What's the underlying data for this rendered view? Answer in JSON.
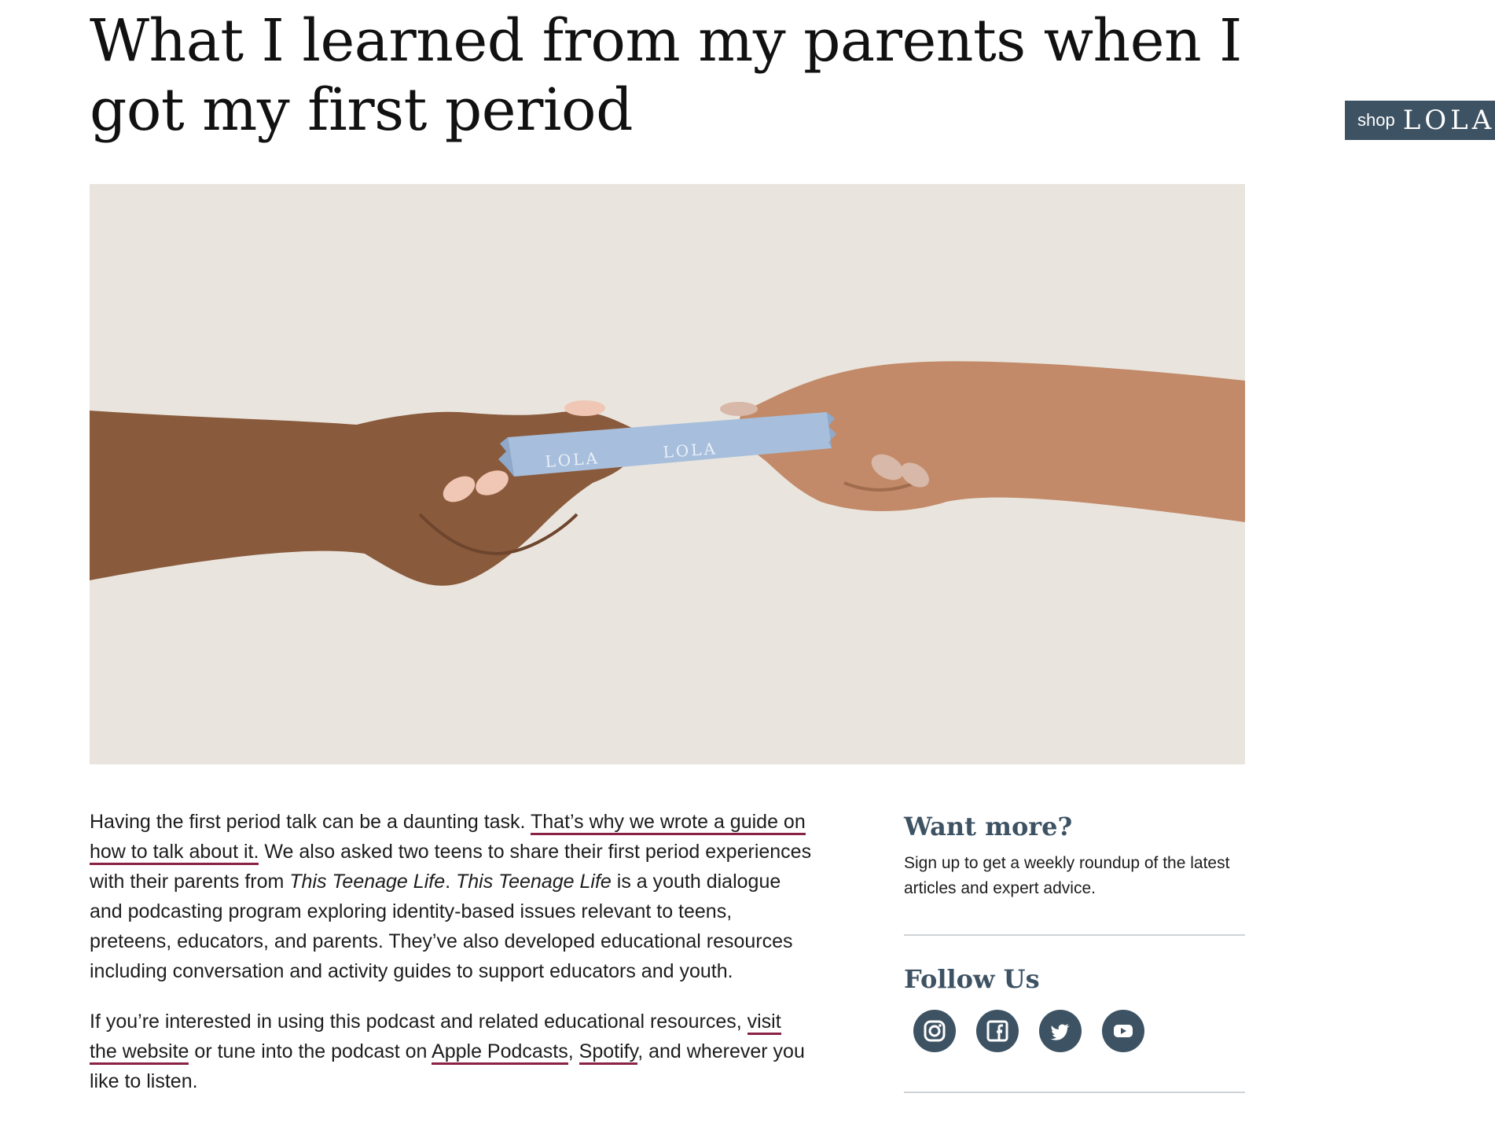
{
  "article": {
    "title": "What I learned from my parents when I got my first period",
    "hero_image_brand": "LOLA",
    "paragraph1": {
      "part1": "Having the first period talk can be a daunting task. ",
      "link1": "That’s why we wrote a guide on how to talk about it.",
      "part2": " We also asked two teens to share their first period experiences with their parents from ",
      "italic1": "This Teenage Life",
      "part3": ". ",
      "italic2": "This Teenage Life",
      "part4": " is a youth dialogue and podcasting program exploring identity-based issues relevant to teens, preteens, educators, and parents. They’ve also developed educational resources including conversation and activity guides to support educators and youth."
    },
    "paragraph2": {
      "part1": "If you’re interested in using this podcast and related educational resources, ",
      "link1": "visit the website",
      "part2": " or tune into the podcast on ",
      "link2": "Apple Podcasts",
      "part3": ", ",
      "link3": "Spotify",
      "part4": ", and wherever you like to listen."
    }
  },
  "shop_tab": {
    "shop": "shop",
    "brand": "LOLA"
  },
  "sidebar": {
    "want_more_heading": "Want more?",
    "want_more_text": "Sign up to get a weekly roundup of the latest articles and expert advice.",
    "follow_heading": "Follow Us",
    "social": [
      "instagram-icon",
      "facebook-icon",
      "twitter-icon",
      "youtube-icon"
    ]
  },
  "colors": {
    "accent": "#3d5263",
    "link_underline": "#8a2147",
    "hero_bg": "#e9e5de"
  }
}
